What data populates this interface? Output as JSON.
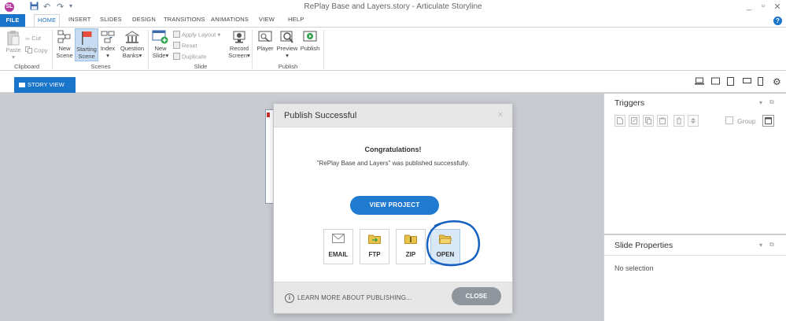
{
  "app": {
    "window_title": "RePlay Base and Layers.story - Articulate Storyline",
    "icon_letter": "SL"
  },
  "window_controls": {
    "minimize": "_",
    "restore": "▫",
    "close": "✕"
  },
  "ribbon_tabs": [
    "FILE",
    "HOME",
    "INSERT",
    "SLIDES",
    "DESIGN",
    "TRANSITIONS",
    "ANIMATIONS",
    "VIEW",
    "HELP"
  ],
  "active_tab": "HOME",
  "help_glyph": "?",
  "ribbon": {
    "clipboard": {
      "paste": "Paste",
      "cut": "Cut",
      "copy": "Copy",
      "label": "Clipboard"
    },
    "scenes": {
      "new_scene_1": "New",
      "new_scene_2": "Scene",
      "starting_scene_1": "Starting",
      "starting_scene_2": "Scene",
      "index": "Index",
      "question_banks_1": "Question",
      "question_banks_2": "Banks",
      "label": "Scenes"
    },
    "slide": {
      "new_slide_1": "New",
      "new_slide_2": "Slide",
      "apply_layout": "Apply Layout",
      "reset": "Reset",
      "duplicate": "Duplicate",
      "label": "Slide"
    },
    "record": {
      "line1": "Record",
      "line2": "Screen"
    },
    "publish_group": {
      "player": "Player",
      "preview": "Preview",
      "publish": "Publish",
      "label": "Publish"
    }
  },
  "view_bar": {
    "story_view": "STORY VIEW"
  },
  "triggers_panel": {
    "title": "Triggers",
    "group_label": "Group"
  },
  "slide_properties_panel": {
    "title": "Slide Properties",
    "empty_text": "No selection"
  },
  "dialog": {
    "title": "Publish Successful",
    "close_glyph": "×",
    "heading": "Congratulations!",
    "message": "\"RePlay Base and Layers\" was published successfully.",
    "view_project": "VIEW PROJECT",
    "options": [
      "EMAIL",
      "FTP",
      "ZIP",
      "OPEN"
    ],
    "info_glyph": "i",
    "learn_more": "LEARN MORE ABOUT PUBLISHING...",
    "close_label": "CLOSE"
  },
  "colors": {
    "accent": "#1a74c9",
    "primary_button": "#1f7ad0",
    "close_button": "#8f969d",
    "annotation": "#1560c0"
  }
}
